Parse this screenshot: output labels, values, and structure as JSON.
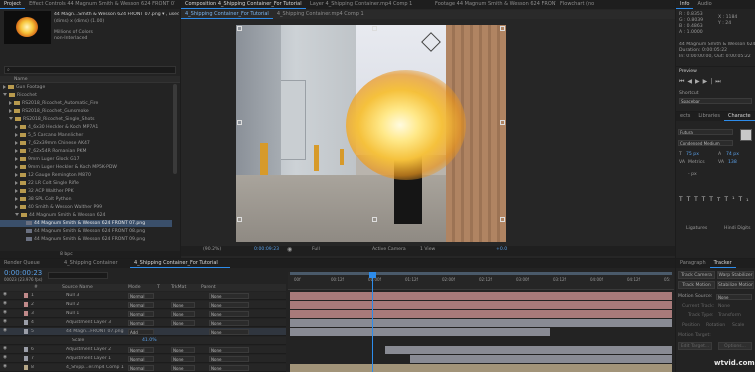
{
  "project": {
    "tab": "Project",
    "effect_controls_tab": "Effect Controls 44 Magnum Smith & Wesson 624 FRONT 07.png",
    "footage_name": "44 Magn...Smith & Wesson 624 FRONT 07.png ▾ , used 1 time",
    "footage_size": "(dims) x (dims) (1.00)",
    "footage_colors": "Millions of Colors",
    "footage_interlace": "non-Interlaced",
    "search_placeholder": "",
    "col_name": "Name",
    "items": [
      {
        "label": "Gun Footage",
        "level": 0,
        "open": false,
        "type": "folder"
      },
      {
        "label": "Ricochet",
        "level": 0,
        "open": true,
        "type": "folder"
      },
      {
        "label": "RS2018_Ricochet_Automatic_Fire",
        "level": 1,
        "open": false,
        "type": "folder"
      },
      {
        "label": "RS2018_Ricochet_Gunsmoke",
        "level": 1,
        "open": false,
        "type": "folder"
      },
      {
        "label": "RS2018_Ricochet_Single_Shots",
        "level": 1,
        "open": true,
        "type": "folder"
      },
      {
        "label": "4_6x30 Heckler & Koch MP7A1",
        "level": 2,
        "open": false,
        "type": "folder"
      },
      {
        "label": "5_5 Carcano Mannlicher",
        "level": 2,
        "open": false,
        "type": "folder"
      },
      {
        "label": "7_62x39mm Chinese AK47",
        "level": 2,
        "open": false,
        "type": "folder"
      },
      {
        "label": "7_62x54R Romanian PKM",
        "level": 2,
        "open": false,
        "type": "folder"
      },
      {
        "label": "9mm Luger Glock G17",
        "level": 2,
        "open": false,
        "type": "folder"
      },
      {
        "label": "9mm Luger Heckler & Koch MP5K-PDW",
        "level": 2,
        "open": false,
        "type": "folder"
      },
      {
        "label": "12 Gauge Remington M870",
        "level": 2,
        "open": false,
        "type": "folder"
      },
      {
        "label": "22 LR Colt Single Rifle",
        "level": 2,
        "open": false,
        "type": "folder"
      },
      {
        "label": "32 ACP Walther PPK",
        "level": 2,
        "open": false,
        "type": "folder"
      },
      {
        "label": "38 SPL Colt Python",
        "level": 2,
        "open": false,
        "type": "folder"
      },
      {
        "label": "40 Smith & Wesson Walther P99",
        "level": 2,
        "open": false,
        "type": "folder"
      },
      {
        "label": "44 Magnum Smith & Wesson 624",
        "level": 2,
        "open": true,
        "type": "folder"
      },
      {
        "label": "44 Magnum Smith & Wesson 624 FRONT 07.png",
        "level": 3,
        "open": false,
        "type": "clip",
        "selected": true
      },
      {
        "label": "44 Magnum Smith & Wesson 624 FRONT 08.png",
        "level": 3,
        "open": false,
        "type": "clip"
      },
      {
        "label": "44 Magnum Smith & Wesson 624 FRONT 09.png",
        "level": 3,
        "open": false,
        "type": "clip"
      }
    ],
    "bpc": "8 bpc"
  },
  "composition": {
    "tabs": [
      "Composition 4_Shipping Container_For Tutorial",
      "Layer 4_Shipping Container.mp4 Comp 1",
      "Footage 44 Magnum Smith & Wesson 624 FRONT 07.png",
      "Flowchart (no"
    ],
    "subtabs": [
      "4_Shipping Container_For Tutorial",
      "4_Shipping Container.mp4 Comp 1"
    ],
    "zoom": "(90.2%)",
    "timecode": "0:00:09:23",
    "resolution": "Full",
    "camera": "Active Camera",
    "view": "1 View",
    "exposure": "+0.0"
  },
  "info": {
    "tabs": [
      "Info",
      "Audio"
    ],
    "r": "R : 0.8353",
    "g": "G : 0.8039",
    "b": "B : 0.4863",
    "a": "A : 1.0000",
    "x": "X : 1184",
    "y": "Y : 24",
    "name": "44 Magnum Smith & Wesson 624 FRONT 07.png",
    "dur": "Duration: 0:00:05:22",
    "inout": "In: 0:00:00:00, Out: 0:00:05:22"
  },
  "preview": {
    "title": "Preview",
    "shortcut_label": "Shortcut",
    "shortcut_value": "Spacebar"
  },
  "character": {
    "tabs": [
      "ects",
      "Libraries",
      "Characte"
    ],
    "font": "Futura",
    "style": "Condensed Medium",
    "size": "75 px",
    "leading": "74 px",
    "kerning": "Metrics",
    "tracking": "138",
    "unit": "- px",
    "ligatures": "Ligatures",
    "hindi": "Hindi Digits"
  },
  "tracker": {
    "tabs": [
      "Paragraph",
      "Tracker"
    ],
    "buttons": [
      "Track Camera",
      "Warp Stabilizer",
      "Track Motion",
      "Stabilize Motion"
    ],
    "motion_source_label": "Motion Source:",
    "motion_source_value": "None",
    "current_track_label": "Current Track:",
    "current_track_value": "None",
    "track_type_label": "Track Type:",
    "track_type_value": "Transform",
    "position": "Position",
    "rotation": "Rotation",
    "scale": "Scale",
    "motion_target": "Motion Target:",
    "edit_target": "Edit Target...",
    "options": "Options..."
  },
  "timeline": {
    "tabs": [
      "Render Queue",
      "4_Shipping Container",
      "4_Shipping Container_For Tutorial"
    ],
    "timecode": "0:00:00:23",
    "frame": "00023 (23.976 fps)",
    "col_headers": [
      "#",
      "Source Name",
      "Mode",
      "T",
      "TrkMat",
      "Parent"
    ],
    "ruler": [
      "00f",
      "00:12f",
      "01:00f",
      "01:12f",
      "02:00f",
      "02:12f",
      "03:00f",
      "03:12f",
      "04:00f",
      "04:12f",
      "05:"
    ],
    "layers": [
      {
        "num": "1",
        "name": "Null 3",
        "mode": "Normal",
        "trk": "",
        "parent": "None",
        "color": "#c08a8a"
      },
      {
        "num": "2",
        "name": "Null 2",
        "mode": "Normal",
        "trk": "None",
        "parent": "None",
        "color": "#c08a8a"
      },
      {
        "num": "3",
        "name": "Null 1",
        "mode": "Normal",
        "trk": "None",
        "parent": "None",
        "color": "#c08a8a"
      },
      {
        "num": "4",
        "name": "Adjustment Layer 3",
        "mode": "Normal",
        "trk": "None",
        "parent": "None",
        "color": "#9b9ea8"
      },
      {
        "num": "5",
        "name": "44 Magn...FRONT 07.png",
        "mode": "Add",
        "trk": "",
        "parent": "None",
        "color": "#9b9ea8"
      },
      {
        "num": "",
        "name": "Scale",
        "mode": "",
        "trk": "",
        "parent": "",
        "color": ""
      },
      {
        "num": "6",
        "name": "Adjustment Layer 2",
        "mode": "Normal",
        "trk": "None",
        "parent": "None",
        "color": "#9b9ea8"
      },
      {
        "num": "7",
        "name": "Adjustment Layer 1",
        "mode": "Normal",
        "trk": "None",
        "parent": "None",
        "color": "#9b9ea8"
      },
      {
        "num": "8",
        "name": "4_Shipp...er.mp4 Comp 1",
        "mode": "Normal",
        "trk": "None",
        "parent": "None",
        "color": "#b8a888"
      }
    ],
    "scale_value": "41.0%"
  },
  "watermark": "wtvid.com"
}
